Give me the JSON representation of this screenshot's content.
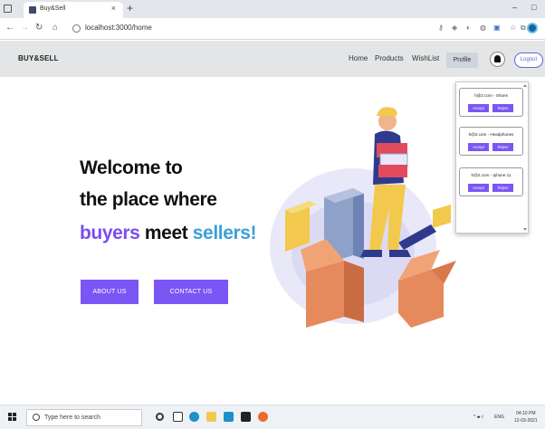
{
  "browser": {
    "tab_title": "Buy&Sell",
    "tab_close": "×",
    "new_tab": "+",
    "url": "localhost:3000/home",
    "minimize": "–",
    "maximize": "□"
  },
  "nav": {
    "brand": "BUY&SELL",
    "links": [
      "Home",
      "Products",
      "WishList"
    ],
    "profile_label": "Profile",
    "logout_label": "Logout"
  },
  "hero": {
    "line1": "Welcome to",
    "line2": "the place where",
    "line3_word1": "buyers",
    "line3_word2": " meet ",
    "line3_word3": "sellers!",
    "about_label": "ABOUT US",
    "contact_label": "CONTACT US"
  },
  "notifications": {
    "items": [
      {
        "text": "h@2.com - Shoes",
        "accept": "Accept",
        "reject": "Reject"
      },
      {
        "text": "h@2.com - Headphones",
        "accept": "Accept",
        "reject": "Reject"
      },
      {
        "text": "h@2.com - Iphone 11",
        "accept": "Accept",
        "reject": "Reject"
      }
    ]
  },
  "taskbar": {
    "search_placeholder": "Type here to search",
    "language": "ENG",
    "time": "04:10 PM",
    "date": "12-03-2021"
  },
  "colors": {
    "accent": "#7b56f5",
    "buyers": "#7b4cf0",
    "sellers": "#3ba0d6",
    "nav_bg": "#e3e5e6"
  },
  "icons": {
    "back": "arrow-left-icon",
    "forward": "arrow-right-icon",
    "reload": "reload-icon",
    "home": "home-icon",
    "bell": "bell-icon"
  }
}
